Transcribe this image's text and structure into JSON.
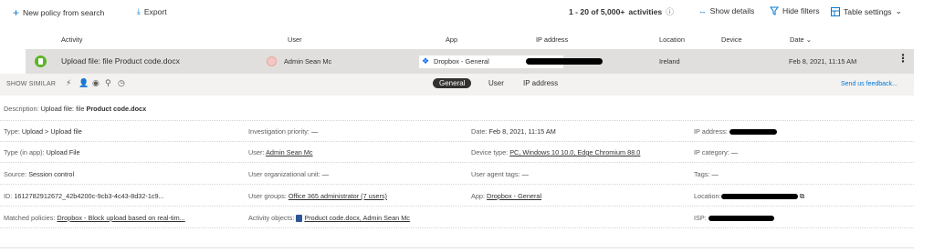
{
  "toolbar": {
    "new_policy": "New policy from search",
    "export": "Export",
    "count_prefix": "1 - 20 of 5,000+",
    "count_suffix": "activities",
    "show_details": "Show details",
    "hide_filters": "Hide filters",
    "table_settings": "Table settings"
  },
  "columns": {
    "activity": "Activity",
    "user": "User",
    "app": "App",
    "ip": "IP address",
    "location": "Location",
    "device": "Device",
    "date": "Date"
  },
  "selected_row": {
    "activity": "Upload file: file Product code.docx",
    "user": "Admin Sean Mc",
    "app": "Dropbox - General",
    "location": "Ireland",
    "date": "Feb 8, 2021, 11:15 AM"
  },
  "similar_bar": {
    "label": "SHOW SIMILAR",
    "tabs": [
      "General",
      "User",
      "IP address"
    ],
    "active_tab": "General",
    "feedback": "Send us feedback..."
  },
  "description": {
    "label": "Description:",
    "prefix": "Upload file: file",
    "bold": "Product code.docx"
  },
  "details": {
    "type_label": "Type:",
    "type_value": "Upload > Upload file",
    "inv_label": "Investigation priority:",
    "inv_value": "—",
    "date_label": "Date:",
    "date_value": "Feb 8, 2021, 11:15 AM",
    "ip_label": "IP address:",
    "typeapp_label": "Type (in app):",
    "typeapp_value": "Upload File",
    "user_label": "User:",
    "user_value": "Admin Sean Mc",
    "devtype_label": "Device type:",
    "devtype_value": "PC, Windows 10 10.0, Edge Chromium 88.0",
    "ipcat_label": "IP category:",
    "ipcat_value": "—",
    "source_label": "Source:",
    "source_value": "Session control",
    "unit_label": "User organizational unit:",
    "unit_value": "—",
    "agent_label": "User agent tags:",
    "agent_value": "—",
    "tags_label": "Tags:",
    "tags_value": "—",
    "id_label": "ID:",
    "id_value": "1612782912672_42b4200c-9cb3-4c43-8d32-1c9...",
    "groups_label": "User groups:",
    "groups_value": "Office 365 administrator (7 users)",
    "app_label": "App:",
    "app_value": "Dropbox - General",
    "loc_label": "Location:",
    "matched_label": "Matched policies:",
    "matched_value": "Dropbox - Block upload based on real-tim...",
    "objects_label": "Activity objects:",
    "objects_value": "Product code.docx, Admin Sean Mc",
    "isp_label": "ISP:"
  }
}
